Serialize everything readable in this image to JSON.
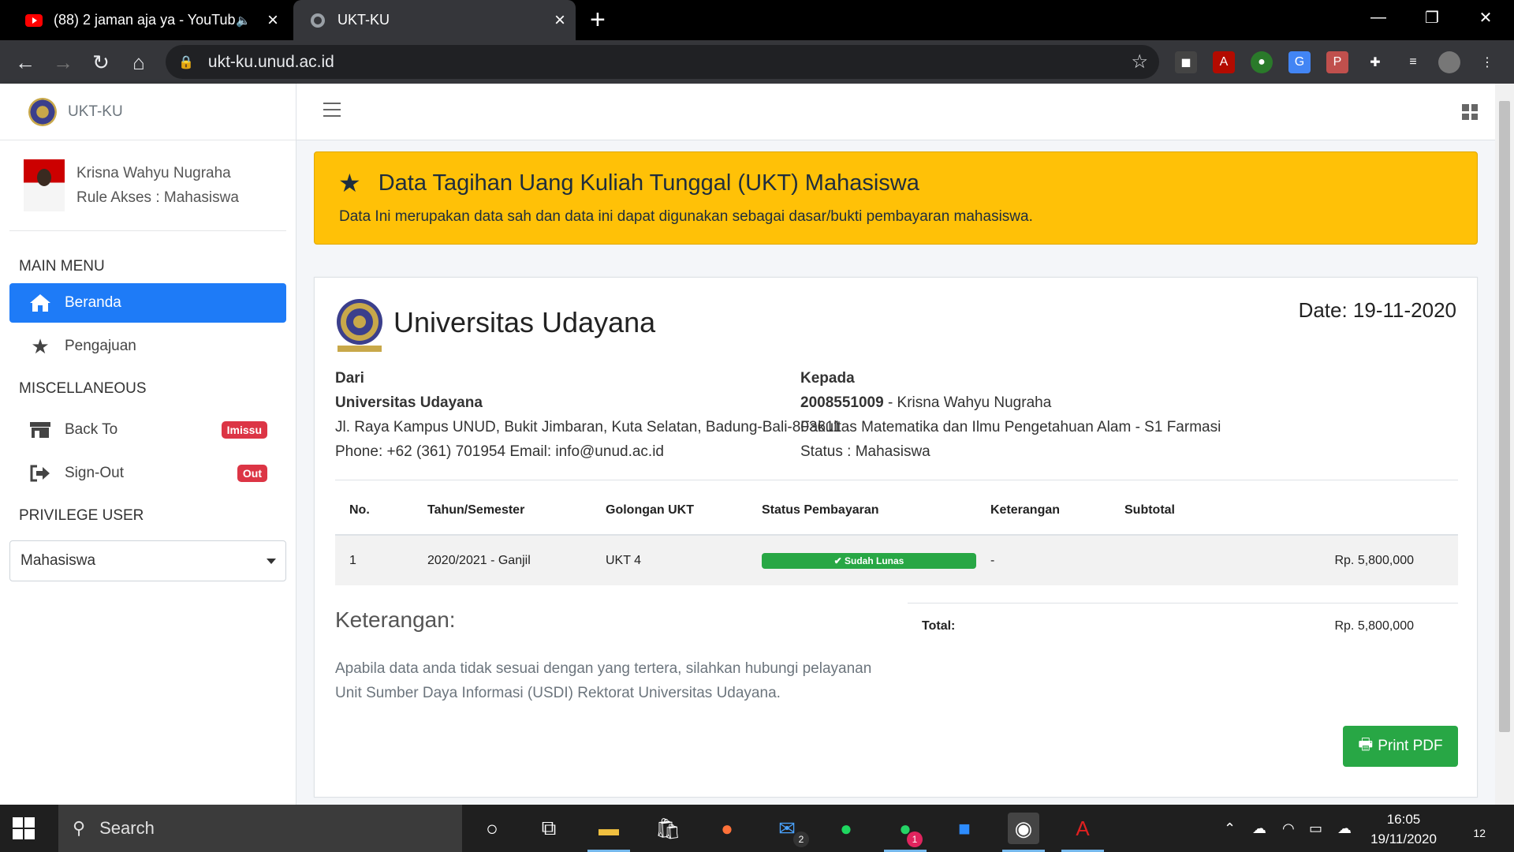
{
  "browser": {
    "tabs": [
      {
        "title": "(88) 2 jaman aja ya - YouTube",
        "active": false
      },
      {
        "title": "UKT-KU",
        "active": true
      }
    ],
    "url": "ukt-ku.unud.ac.id"
  },
  "sidebar": {
    "brand": "UKT-KU",
    "user_name": "Krisna Wahyu Nugraha",
    "user_role": "Rule Akses : Mahasiswa",
    "main_menu_heading": "MAIN MENU",
    "items": [
      {
        "label": "Beranda",
        "icon": "home-icon",
        "active": true
      },
      {
        "label": "Pengajuan",
        "icon": "star-icon",
        "active": false
      }
    ],
    "misc_heading": "MISCELLANEOUS",
    "misc_items": [
      {
        "label": "Back To",
        "icon": "store-icon",
        "badge": "Imissu"
      },
      {
        "label": "Sign-Out",
        "icon": "sign-out-icon",
        "badge": "Out"
      }
    ],
    "privilege_heading": "PRIVILEGE USER",
    "privilege_value": "Mahasiswa"
  },
  "callout": {
    "title": "Data Tagihan Uang Kuliah Tunggal (UKT) Mahasiswa",
    "text": "Data Ini merupakan data sah dan data ini dapat digunakan sebagai dasar/bukti pembayaran mahasiswa."
  },
  "invoice": {
    "university": "Universitas Udayana",
    "date": "Date: 19-11-2020",
    "from": {
      "label": "Dari",
      "name": "Universitas Udayana",
      "address": "Jl. Raya Kampus UNUD, Bukit Jimbaran, Kuta Selatan, Badung-Bali-803611",
      "contact": "Phone: +62 (361) 701954 Email: info@unud.ac.id"
    },
    "to": {
      "label": "Kepada",
      "nim": "2008551009",
      "name": " - Krisna Wahyu Nugraha",
      "faculty": "Fakultas Matematika dan Ilmu Pengetahuan Alam - S1 Farmasi",
      "status": "Status : Mahasiswa"
    },
    "columns": [
      "No.",
      "Tahun/Semester",
      "Golongan UKT",
      "Status Pembayaran",
      "Keterangan",
      "Subtotal"
    ],
    "rows": [
      {
        "no": "1",
        "semester": "2020/2021 - Ganjil",
        "golongan": "UKT 4",
        "status": "Sudah Lunas",
        "keterangan": "-",
        "subtotal": "Rp. 5,800,000"
      }
    ],
    "note_heading": "Keterangan:",
    "note_text": "Apabila data anda tidak sesuai dengan yang tertera, silahkan hubungi pelayanan Unit Sumber Daya Informasi (USDI) Rektorat Universitas Udayana.",
    "total_label": "Total:",
    "total_value": "Rp. 5,800,000",
    "print_label": "Print PDF"
  },
  "taskbar": {
    "search_label": "Search",
    "time": "16:05",
    "date": "19/11/2020",
    "mail_badge": "2",
    "whatsapp_badge": "1",
    "notifications": "12"
  },
  "colors": {
    "primary": "#1e7bf7",
    "warning": "#ffc107",
    "success": "#28a745",
    "danger": "#dc3545"
  }
}
